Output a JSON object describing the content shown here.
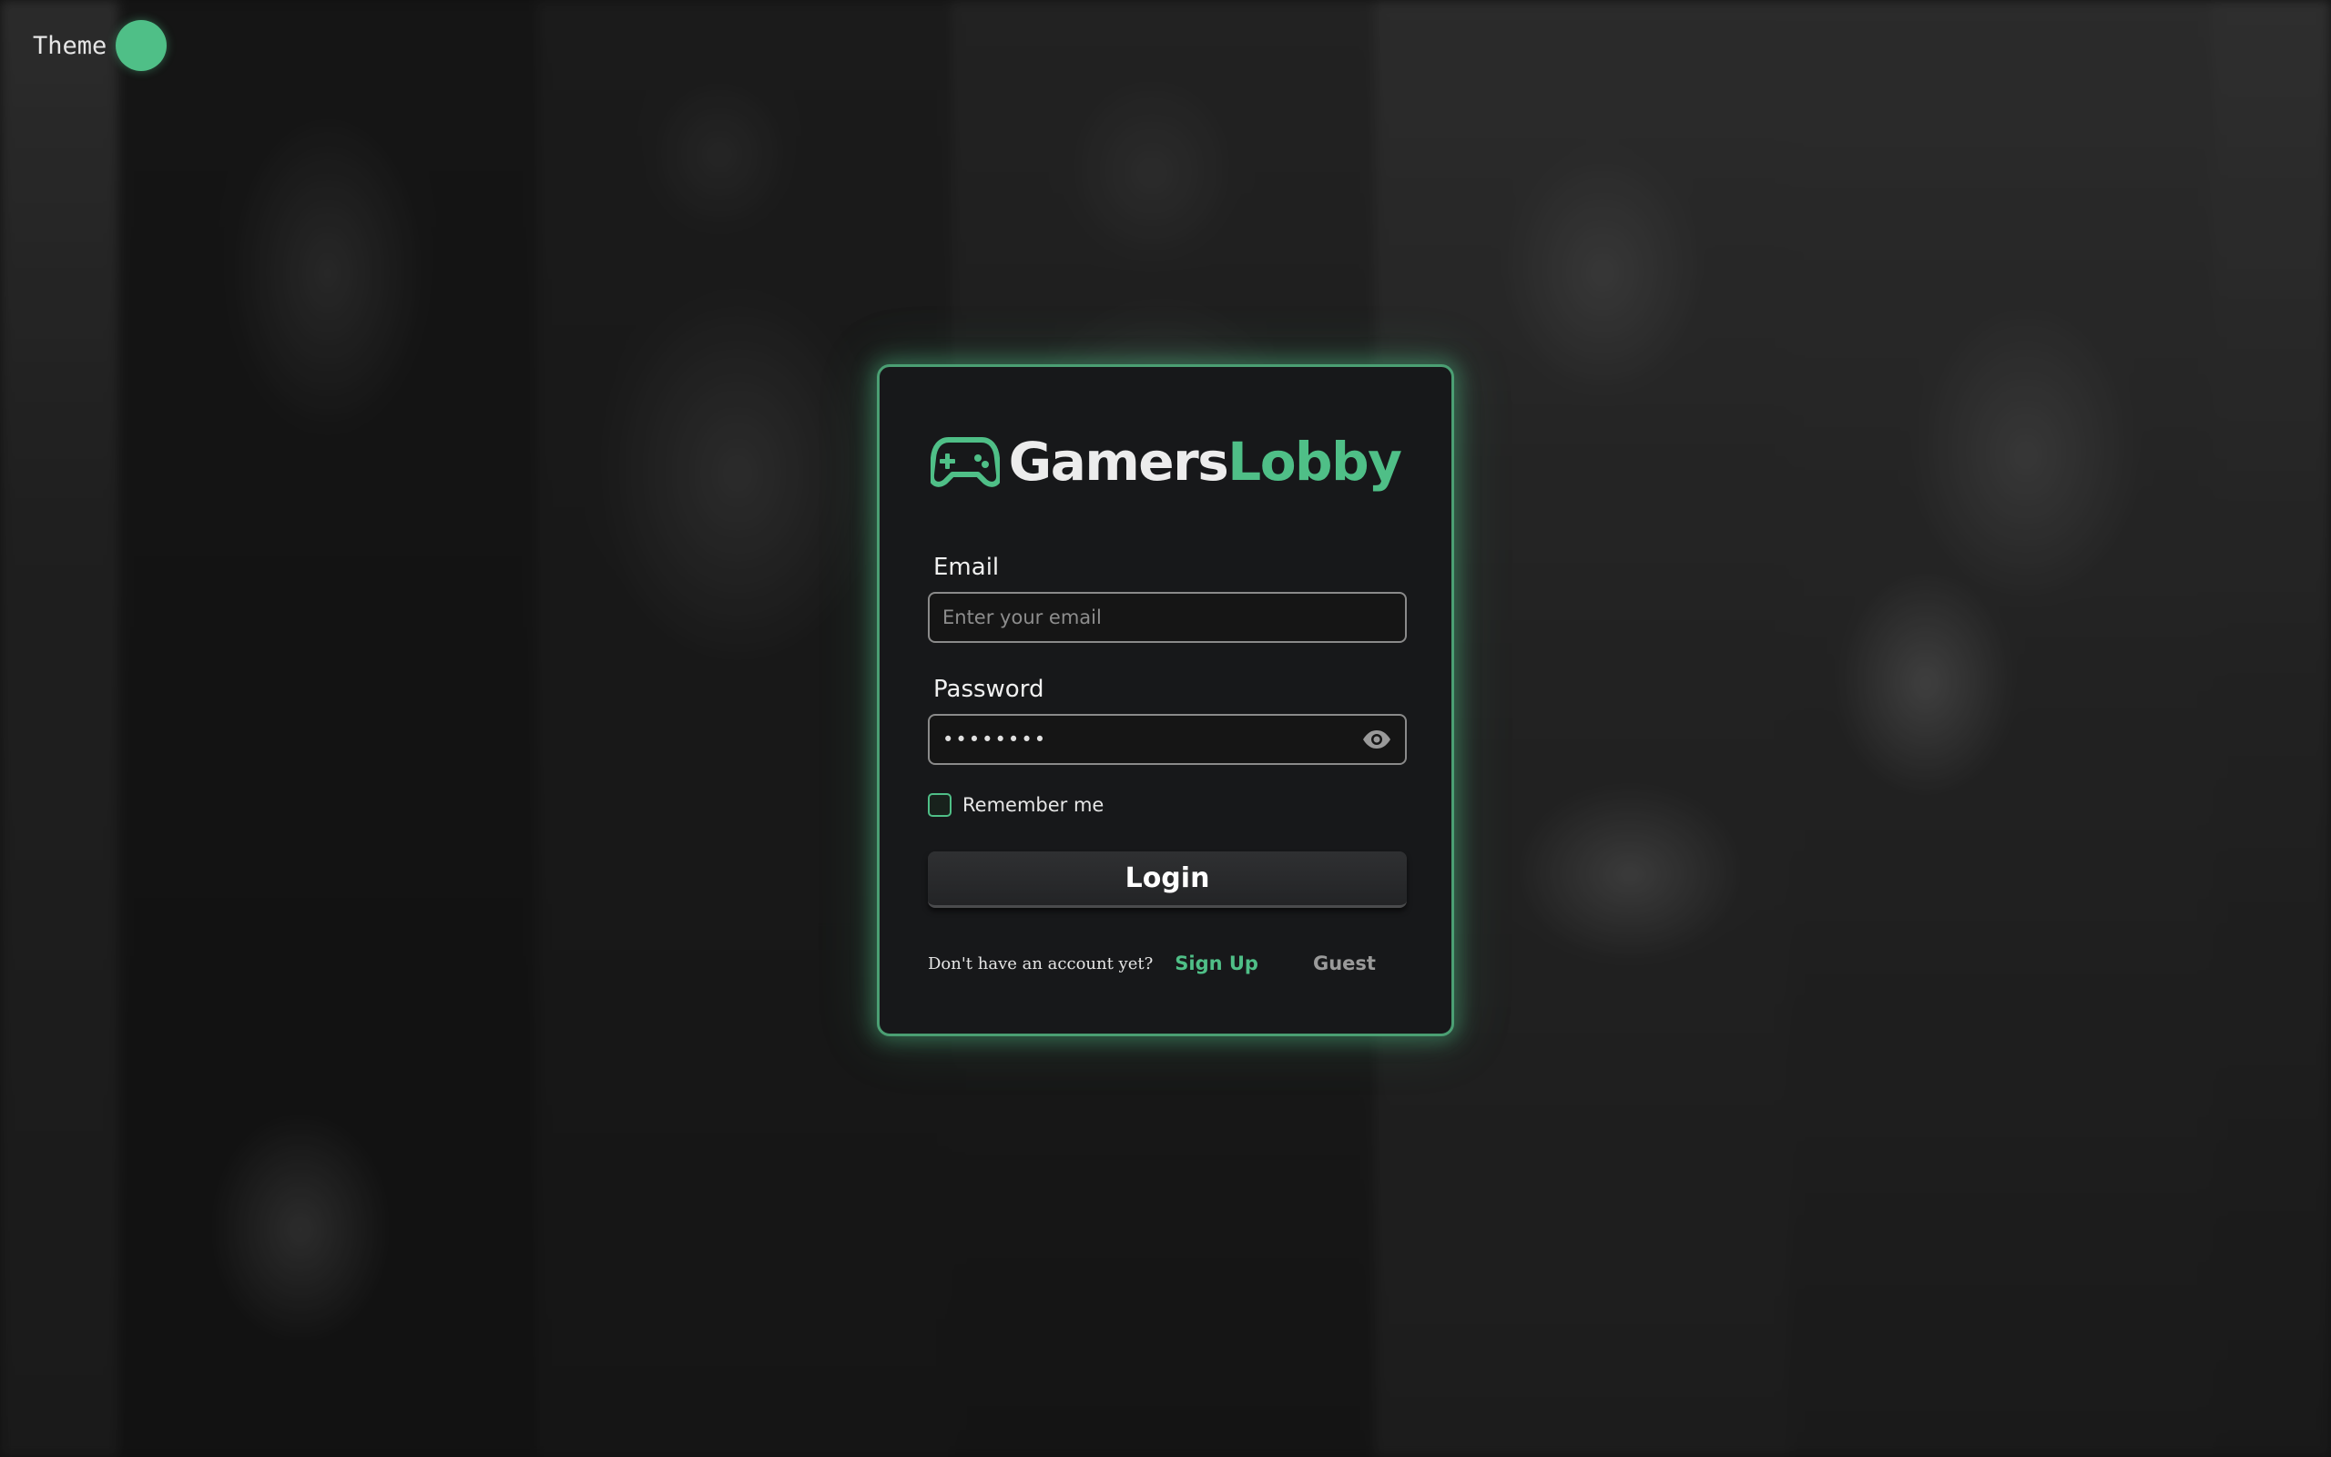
{
  "theme": {
    "label": "Theme",
    "accent_color": "#4fbf87"
  },
  "logo": {
    "icon": "gamepad-icon",
    "part1": "Gamers",
    "part2": "Lobby"
  },
  "email": {
    "label": "Email",
    "placeholder": "Enter your email",
    "value": ""
  },
  "password": {
    "label": "Password",
    "value": "••••••••",
    "toggle_icon": "eye-icon"
  },
  "remember": {
    "label": "Remember me",
    "checked": false
  },
  "login": {
    "label": "Login"
  },
  "footer": {
    "prompt": "Don't have an account yet?",
    "signup_label": "Sign Up",
    "guest_label": "Guest"
  },
  "colors": {
    "accent": "#4fbf87",
    "card_background": "#17181a",
    "card_border": "#4b9f73"
  }
}
